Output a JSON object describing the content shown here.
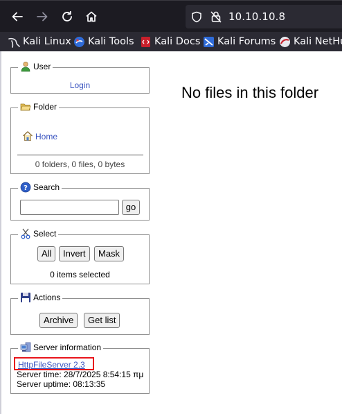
{
  "browser": {
    "url": "10.10.10.8",
    "bookmarks": [
      "Kali Linux",
      "Kali Tools",
      "Kali Docs",
      "Kali Forums",
      "Kali NetHunter"
    ]
  },
  "panels": {
    "user": {
      "title": "User",
      "login": "Login"
    },
    "folder": {
      "title": "Folder",
      "home": "Home",
      "summary": "0 folders, 0 files, 0 bytes"
    },
    "search": {
      "title": "Search",
      "query": "",
      "go": "go"
    },
    "select": {
      "title": "Select",
      "all": "All",
      "invert": "Invert",
      "mask": "Mask",
      "status": "0 items selected"
    },
    "actions": {
      "title": "Actions",
      "archive": "Archive",
      "getlist": "Get list"
    },
    "server": {
      "title": "Server information",
      "software": "HttpFileServer 2.3",
      "time": "Server time: 28/7/2025 8:54:15 πμ",
      "uptime": "Server uptime: 08:13:35"
    }
  },
  "main": {
    "message": "No files in this folder"
  },
  "colors": {
    "highlight_box": "#e8141b",
    "link": "#3b55c0"
  }
}
